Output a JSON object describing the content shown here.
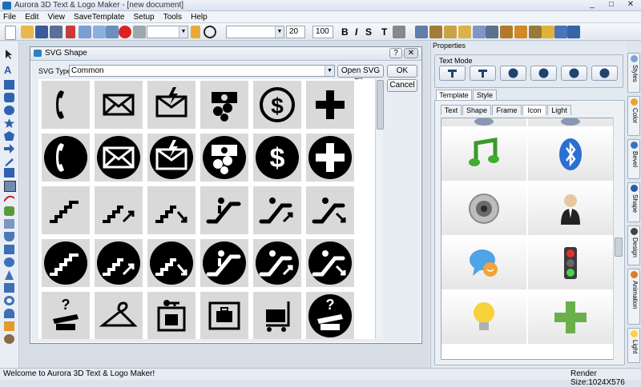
{
  "window": {
    "title": "Aurora 3D Text & Logo Maker - [new document]",
    "controls": [
      "_",
      "□",
      "✕"
    ]
  },
  "menu": [
    "File",
    "Edit",
    "View",
    "SaveTemplate",
    "Setup",
    "Tools",
    "Help"
  ],
  "toolbar": {
    "font_size": "20",
    "zoom": "100",
    "bold": "B",
    "italic": "I",
    "strike": "S",
    "text_style": "T"
  },
  "dialog": {
    "title": "SVG Shape",
    "help": "?",
    "close": "✕",
    "svg_type_label": "SVG Type",
    "svg_type_value": "Common",
    "open_button": "Open SVG File",
    "ok_button": "OK",
    "cancel_button": "Cancel",
    "shapes": [
      "phone",
      "envelope",
      "envelope-flash",
      "money-transfer",
      "dollar",
      "cross",
      "phone-circle",
      "envelope-circle",
      "envelope-flash-circle",
      "money-transfer-circle",
      "dollar-circle",
      "cross-circle",
      "stairs",
      "stairs-up",
      "stairs-down",
      "escalator",
      "escalator-up",
      "escalator-down",
      "stairs-circle",
      "stairs-up-circle",
      "stairs-down-circle",
      "escalator-circle",
      "escalator-up-circle",
      "escalator-down-circle",
      "lost-found",
      "coat-hanger",
      "baggage-lockers",
      "baggage-claim",
      "baggage-cart",
      "lost-found-circle"
    ]
  },
  "properties": {
    "title": "Properties",
    "text_mode_label": "Text Mode",
    "tabs": [
      "Template",
      "Style"
    ],
    "subtabs": [
      "Text",
      "Shape",
      "Frame",
      "Icon",
      "Light"
    ],
    "selected_subtab": "Icon",
    "icons": [
      "music-note",
      "bluetooth",
      "speaker",
      "user-avatar",
      "chat-bubble",
      "traffic-light",
      "light-bulb",
      "green-cross"
    ]
  },
  "right_tabs": [
    "Styles",
    "Color",
    "Bevel",
    "Shape",
    "Design",
    "Animation",
    "Light"
  ],
  "status": {
    "message": "Welcome to Aurora 3D Text & Logo Maker!",
    "render_size": "Render Size:1024X576"
  },
  "colors": {
    "accent": "#1e6fb8",
    "panel": "#e3e9f0"
  }
}
